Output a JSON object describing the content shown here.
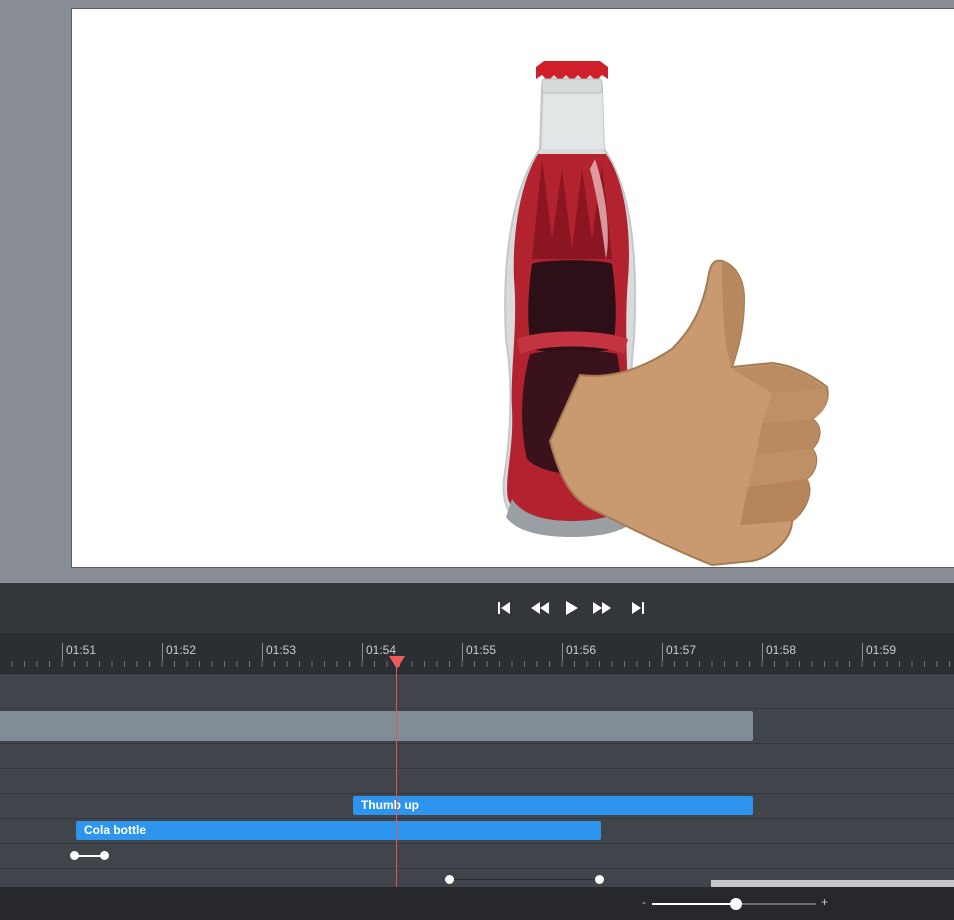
{
  "canvas": {
    "bottle_label": "cola-bottle-illustration",
    "hand_label": "thumbs-up-illustration"
  },
  "transport": {
    "buttons": [
      "skip-to-start-icon",
      "rewind-icon",
      "play-icon",
      "fast-forward-icon",
      "skip-to-end-icon"
    ]
  },
  "ruler": {
    "labels": [
      "01:51",
      "01:52",
      "01:53",
      "01:54",
      "01:55",
      "01:56",
      "01:57",
      "01:58",
      "01:59"
    ]
  },
  "tracks": {
    "thumb_clip": "Thumb up",
    "bottle_clip": "Cola bottle"
  },
  "zoom": {
    "minus": "-",
    "plus": "+",
    "value": 0.51
  },
  "colors": {
    "clip_blue": "#2e95ef",
    "playhead": "#ef5b5b"
  }
}
